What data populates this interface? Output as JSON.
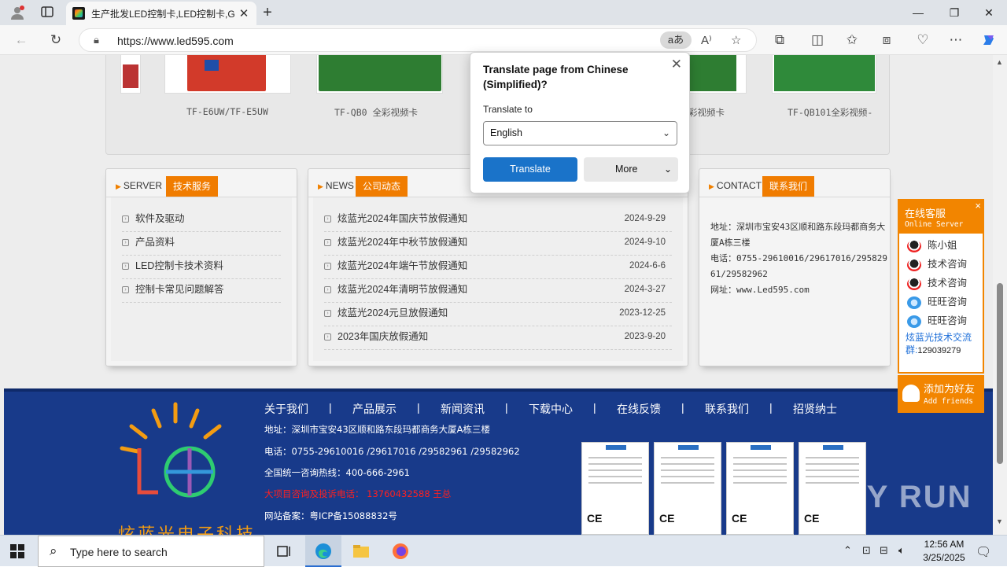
{
  "browser": {
    "tab_title": "生产批发LED控制卡,LED控制卡,G",
    "url": "https://www.led595.com",
    "translate_pill": "aあ"
  },
  "products": {
    "captions": [
      "TF-E6UW/TF-E5UW",
      "TF-QB0 全彩视频卡",
      "彩视频卡",
      "TF-QB101全彩视频-"
    ]
  },
  "server": {
    "en": "SERVER",
    "cn": "技术服务",
    "items": [
      "软件及驱动",
      "产品资料",
      "LED控制卡技术资料",
      "控制卡常见问题解答"
    ]
  },
  "news": {
    "en": "NEWS",
    "cn": "公司动态",
    "items": [
      {
        "title": "炫蓝光2024年国庆节放假通知",
        "date": "2024-9-29"
      },
      {
        "title": "炫蓝光2024年中秋节放假通知",
        "date": "2024-9-10"
      },
      {
        "title": "炫蓝光2024年端午节放假通知",
        "date": "2024-6-6"
      },
      {
        "title": "炫蓝光2024年清明节放假通知",
        "date": "2024-3-27"
      },
      {
        "title": "炫蓝光2024元旦放假通知",
        "date": "2023-12-25"
      },
      {
        "title": "2023年国庆放假通知",
        "date": "2023-9-20"
      }
    ]
  },
  "contact": {
    "en": "CONTACT",
    "cn": "联系我们",
    "address": "地址：深圳市宝安43区顺和路东段玛都商务大厦A栋三楼",
    "phone": "电话：0755-29610016/29617016/29582961/29582962",
    "web": "网址：www.Led595.com"
  },
  "footer": {
    "nav": [
      "关于我们",
      "产品展示",
      "新闻资讯",
      "下载中心",
      "在线反馈",
      "联系我们",
      "招贤纳士"
    ],
    "separator": "|",
    "address": "地址：深圳市宝安43区顺和路东段玛都商务大厦A栋三楼",
    "phone": "电话：0755-29610016 /29617016 /29582961 /29582962",
    "hotline": "全国统一咨询热线：400-666-2961",
    "complaint": "大项目咨询及投诉电话： 13760432588 王总",
    "icp": "网站备案：粤ICP备15088832号",
    "logo_text": "炫蓝光电子科技",
    "watermark": "ANY RUN"
  },
  "chat": {
    "title": "在线客服",
    "subtitle": "Online Server",
    "close": "×",
    "contacts": [
      {
        "name": "陈小姐",
        "icon": "qq-icon"
      },
      {
        "name": "技术咨询",
        "icon": "qq-icon"
      },
      {
        "name": "技术咨询",
        "icon": "qq-icon"
      },
      {
        "name": "旺旺咨询",
        "icon": "wangwang-icon"
      },
      {
        "name": "旺旺咨询",
        "icon": "wangwang-icon"
      }
    ],
    "group_label": "炫蓝光技术交流群:",
    "group_number": "129039279",
    "add_friend": "添加为好友",
    "add_friend_en": "Add friends"
  },
  "translate_popup": {
    "heading": "Translate page from Chinese (Simplified)?",
    "label": "Translate to",
    "selected": "English",
    "translate_btn": "Translate",
    "more_btn": "More"
  },
  "taskbar": {
    "search_placeholder": "Type here to search",
    "time": "12:56 AM",
    "date": "3/25/2025"
  },
  "colors": {
    "accent_orange": "#f07c00",
    "footer_blue": "#183a8a",
    "translate_blue": "#1a73c9"
  }
}
